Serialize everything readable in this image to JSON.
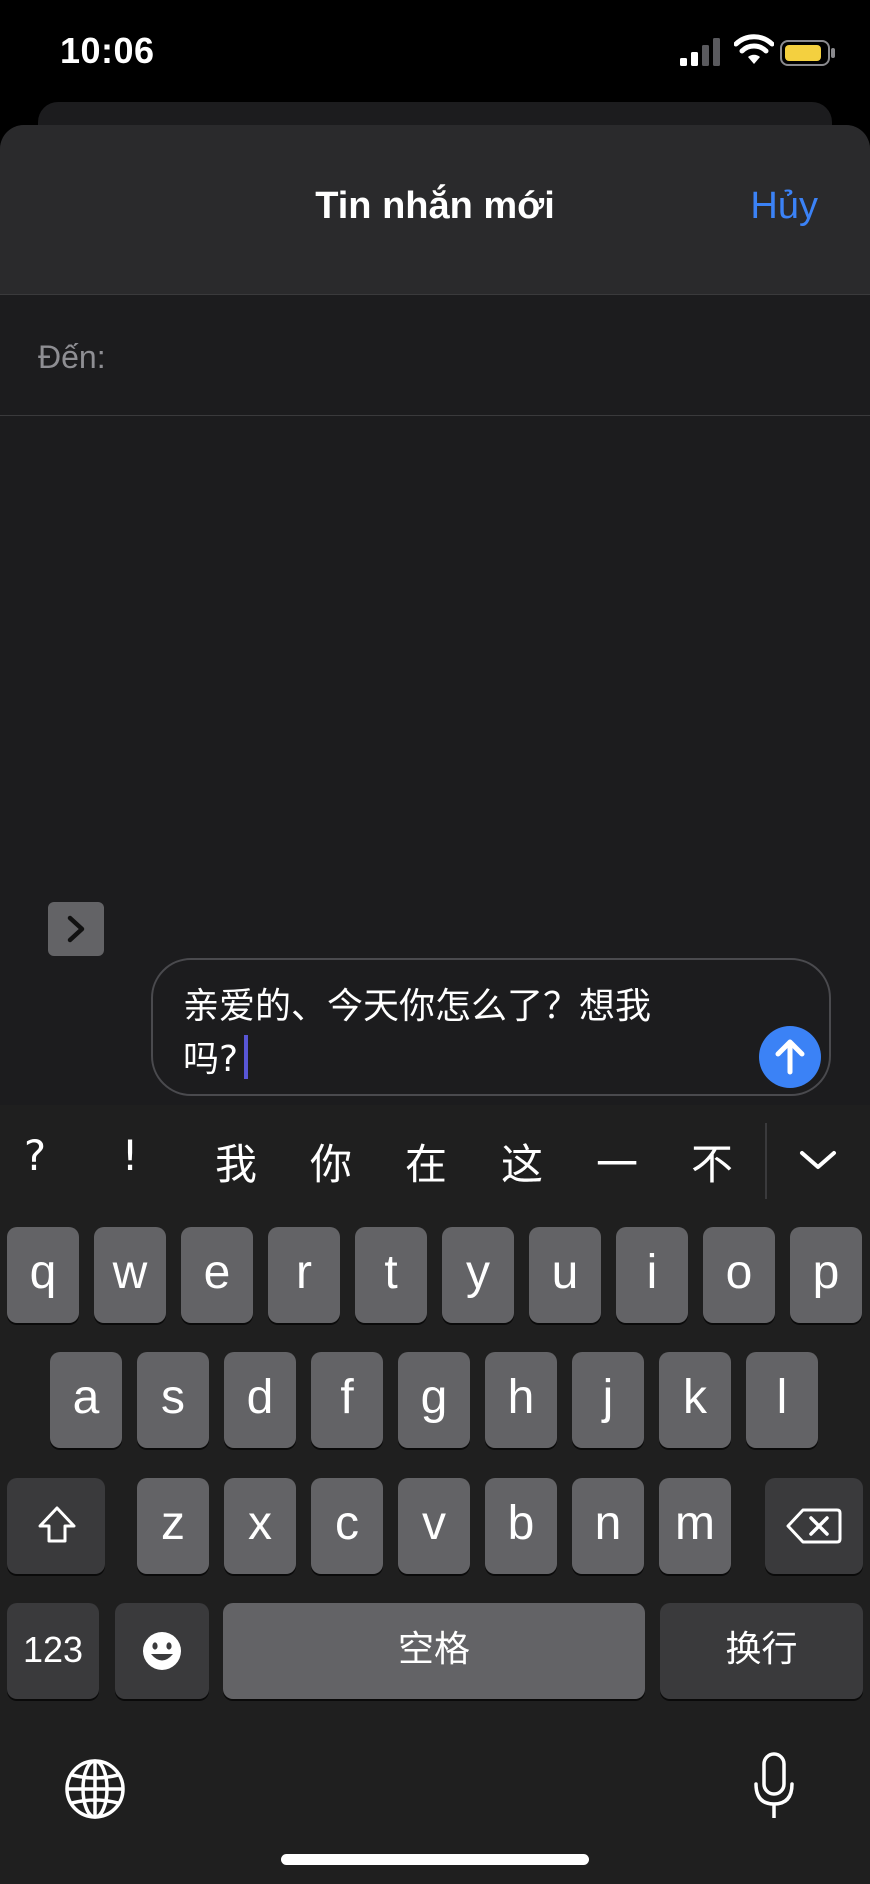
{
  "status_bar": {
    "time": "10:06"
  },
  "nav": {
    "title": "Tin nhắn mới",
    "cancel_label": "Hủy"
  },
  "recipient": {
    "label": "Đến:"
  },
  "compose": {
    "text_line1": "亲爱的、今天你怎么了？想我",
    "text_line2": "吗?"
  },
  "candidates": [
    "?",
    "!",
    "我",
    "你",
    "在",
    "这",
    "一",
    "不"
  ],
  "keyboard": {
    "row1": [
      "q",
      "w",
      "e",
      "r",
      "t",
      "y",
      "u",
      "i",
      "o",
      "p"
    ],
    "row2": [
      "a",
      "s",
      "d",
      "f",
      "g",
      "h",
      "j",
      "k",
      "l"
    ],
    "row3": [
      "z",
      "x",
      "c",
      "v",
      "b",
      "n",
      "m"
    ],
    "numbers_label": "123",
    "space_label": "空格",
    "return_label": "换行"
  },
  "colors": {
    "accent": "#3b82f6",
    "caret": "#5856d6",
    "battery": "#f4d03f"
  }
}
